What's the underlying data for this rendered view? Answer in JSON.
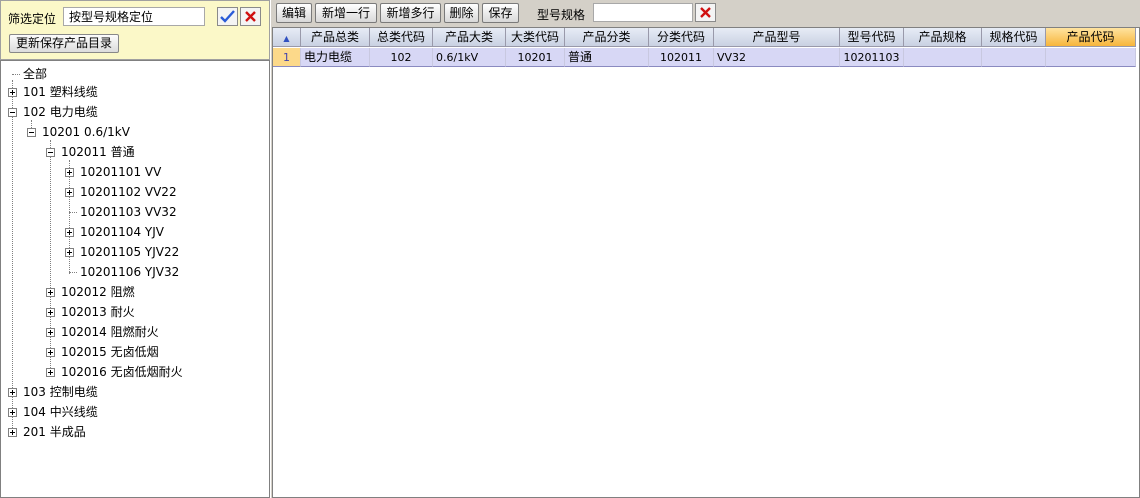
{
  "filter": {
    "label": "筛选定位",
    "value": "按型号规格定位",
    "update_button": "更新保存产品目录"
  },
  "tree": {
    "nodes": [
      {
        "label": "全部"
      },
      {
        "label": "101 塑料线缆"
      },
      {
        "label": "102 电力电缆"
      },
      {
        "label": "10201 0.6/1kV"
      },
      {
        "label": "102011 普通"
      },
      {
        "label": "10201101 VV"
      },
      {
        "label": "10201102 VV22"
      },
      {
        "label": "10201103 VV32"
      },
      {
        "label": "10201104 YJV"
      },
      {
        "label": "10201105 YJV22"
      },
      {
        "label": "10201106 YJV32"
      },
      {
        "label": "102012 阻燃"
      },
      {
        "label": "102013 耐火"
      },
      {
        "label": "102014 阻燃耐火"
      },
      {
        "label": "102015 无卤低烟"
      },
      {
        "label": "102016 无卤低烟耐火"
      },
      {
        "label": "103 控制电缆"
      },
      {
        "label": "104 中兴线缆"
      },
      {
        "label": "201 半成品"
      }
    ]
  },
  "toolbar": {
    "edit": "编辑",
    "add_row": "新增一行",
    "add_rows": "新增多行",
    "delete": "删除",
    "save": "保存",
    "model_spec_label": "型号规格",
    "model_spec_value": ""
  },
  "grid": {
    "columns": [
      "产品总类",
      "总类代码",
      "产品大类",
      "大类代码",
      "产品分类",
      "分类代码",
      "产品型号",
      "型号代码",
      "产品规格",
      "规格代码",
      "产品代码"
    ],
    "rows": [
      {
        "num": "1",
        "cells": [
          "电力电缆",
          "102",
          "0.6/1kV",
          "10201",
          "普通",
          "102011",
          "VV32",
          "10201103",
          "",
          "",
          ""
        ]
      }
    ]
  },
  "colors": {
    "filter_bg": "#fbf8c8",
    "row_selected": "#d7d7f5",
    "active_header": "#f7b53b"
  }
}
